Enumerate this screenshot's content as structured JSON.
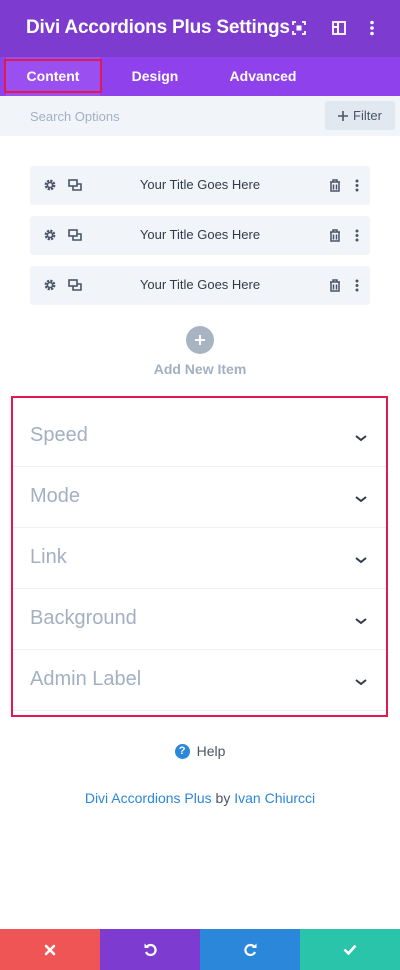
{
  "header": {
    "title": "Divi Accordions Plus Settings",
    "icons": [
      "expand-icon",
      "sidebar-layout-icon",
      "more-vertical-icon"
    ]
  },
  "tabs": [
    {
      "label": "Content",
      "active": true
    },
    {
      "label": "Design",
      "active": false
    },
    {
      "label": "Advanced",
      "active": false
    }
  ],
  "search": {
    "placeholder": "Search Options",
    "value": "",
    "filter_label": "Filter"
  },
  "items": [
    {
      "title": "Your Title Goes Here"
    },
    {
      "title": "Your Title Goes Here"
    },
    {
      "title": "Your Title Goes Here"
    }
  ],
  "add_item": {
    "label": "Add New Item"
  },
  "toggles": [
    {
      "label": "Speed"
    },
    {
      "label": "Mode"
    },
    {
      "label": "Link"
    },
    {
      "label": "Background"
    },
    {
      "label": "Admin Label"
    }
  ],
  "help": {
    "label": "Help"
  },
  "credit": {
    "plugin": "Divi Accordions Plus",
    "by": "by",
    "author": "Ivan Chiurcci"
  },
  "footer": {
    "buttons": [
      {
        "name": "discard",
        "icon": "close-icon",
        "color": "#ef5555"
      },
      {
        "name": "undo",
        "icon": "undo-icon",
        "color": "#7e3bd0"
      },
      {
        "name": "redo",
        "icon": "redo-icon",
        "color": "#2b87da"
      },
      {
        "name": "save",
        "icon": "check-icon",
        "color": "#29c4a9"
      }
    ]
  },
  "colors": {
    "header_bg": "#7e3bd0",
    "tabs_bg": "#8f42ec",
    "highlight": "#e01a4f",
    "link": "#2b87da"
  }
}
